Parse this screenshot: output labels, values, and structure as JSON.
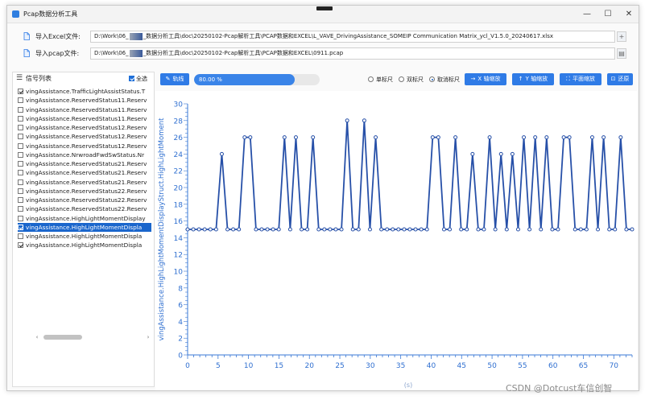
{
  "window": {
    "title": "Pcap数据分析工具",
    "controls": {
      "minimize": "—",
      "maximize": "☐",
      "close": "✕"
    }
  },
  "excel": {
    "label": "导入Excel文件:",
    "path_prefix": "D:\\Work\\06_",
    "path_suffix": "_数据分析工具\\doc\\20250102-Pcap解析工具\\PCAP数据和EXCEL\\L_VAVE_DrivingAssistance_SOMEIP Communication Matrix_ycl_V1.5.0_20240617.xlsx",
    "browse": "+"
  },
  "pcap": {
    "label": "导入pcap文件:",
    "path_prefix": "D:\\Work\\06_",
    "path_suffix": "_数据分析工具\\doc\\20250102-Pcap解析工具\\PCAP数据和EXCEL\\0911.pcap",
    "browse": "▤"
  },
  "signals": {
    "title": "信号列表",
    "select_all": "全选",
    "items": [
      {
        "label": "vingAssistance.TrafficLightAssistStatus.T",
        "checked": true,
        "selected": false
      },
      {
        "label": "vingAssistance.ReservedStatus11.Reserv",
        "checked": false,
        "selected": false
      },
      {
        "label": "vingAssistance.ReservedStatus11.Reserv",
        "checked": false,
        "selected": false
      },
      {
        "label": "vingAssistance.ReservedStatus11.Reserv",
        "checked": false,
        "selected": false
      },
      {
        "label": "vingAssistance.ReservedStatus12.Reserv",
        "checked": false,
        "selected": false
      },
      {
        "label": "vingAssistance.ReservedStatus12.Reserv",
        "checked": false,
        "selected": false
      },
      {
        "label": "vingAssistance.ReservedStatus12.Reserv",
        "checked": false,
        "selected": false
      },
      {
        "label": "vingAssistance.NrwroadFwdSwStatus.Nr",
        "checked": false,
        "selected": false
      },
      {
        "label": "vingAssistance.ReservedStatus21.Reserv",
        "checked": false,
        "selected": false
      },
      {
        "label": "vingAssistance.ReservedStatus21.Reserv",
        "checked": false,
        "selected": false
      },
      {
        "label": "vingAssistance.ReservedStatus21.Reserv",
        "checked": false,
        "selected": false
      },
      {
        "label": "vingAssistance.ReservedStatus22.Reserv",
        "checked": false,
        "selected": false
      },
      {
        "label": "vingAssistance.ReservedStatus22.Reserv",
        "checked": false,
        "selected": false
      },
      {
        "label": "vingAssistance.ReservedStatus22.Reserv",
        "checked": false,
        "selected": false
      },
      {
        "label": "vingAssistance.HighLightMomentDisplay",
        "checked": false,
        "selected": false
      },
      {
        "label": "vingAssistance.HighLightMomentDispla",
        "checked": true,
        "selected": true
      },
      {
        "label": "vingAssistance.HighLightMomentDispla",
        "checked": false,
        "selected": false
      },
      {
        "label": "vingAssistance.HighLightMomentDispla",
        "checked": true,
        "selected": false
      }
    ],
    "scroll_left": "‹",
    "scroll_right": "›"
  },
  "toolbar": {
    "clear_label": "轨线",
    "progress_text": "80.00 %",
    "progress_value": 0.8,
    "radio_single": "单标尺",
    "radio_double": "双标尺",
    "radio_cancel": "取消标尺",
    "radio_selected": "cancel",
    "x_zoom": "X 轴缩放",
    "y_zoom": "Y 轴缩放",
    "pan_zoom": "平面缩放",
    "restore": "还原"
  },
  "colors": {
    "accent": "#2f7be6",
    "selection": "#1a66cc",
    "series": "#2750a8"
  },
  "chart_data": {
    "type": "line",
    "ylabel": "vingAssistance.HighLightMomentDisplayStruct.HighLightMoment",
    "xlabel": "(s)",
    "xlim": [
      0,
      73
    ],
    "ylim": [
      0,
      30
    ],
    "xticks": [
      0,
      5,
      10,
      15,
      20,
      25,
      30,
      35,
      40,
      45,
      50,
      55,
      60,
      65,
      70
    ],
    "yticks": [
      0,
      2,
      4,
      6,
      8,
      10,
      12,
      14,
      16,
      18,
      20,
      22,
      24,
      26,
      28,
      30
    ],
    "grid": false,
    "series": [
      {
        "values": [
          15,
          15,
          15,
          15,
          15,
          15,
          24,
          15,
          15,
          15,
          26,
          26,
          15,
          15,
          15,
          15,
          15,
          26,
          15,
          26,
          15,
          15,
          26,
          15,
          15,
          15,
          15,
          15,
          28,
          15,
          15,
          28,
          15,
          26,
          15,
          15,
          15,
          15,
          15,
          15,
          15,
          15,
          15,
          26,
          26,
          15,
          15,
          26,
          15,
          15,
          24,
          15,
          15,
          26,
          15,
          24,
          15,
          24,
          15,
          26,
          15,
          26,
          15,
          26,
          15,
          15,
          26,
          26,
          15,
          15,
          15,
          26,
          15,
          26,
          15,
          15,
          26,
          15,
          15
        ]
      }
    ]
  },
  "watermark": "CSDN @Dotcust车信创智"
}
